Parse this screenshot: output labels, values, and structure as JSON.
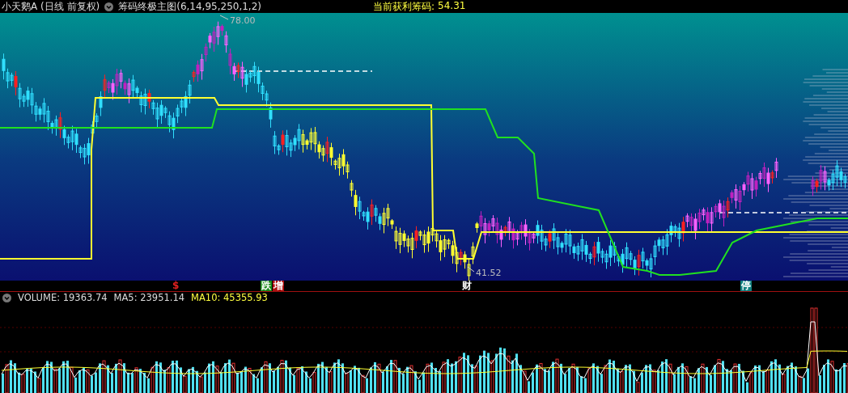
{
  "header": {
    "title": "小天鹅A (日线 前复权)",
    "indicator": "筹码终极主图(6,14,95,250,1,2)",
    "profit_label": "当前获利筹码:",
    "profit_value": "54.31"
  },
  "main_chart": {
    "high_label": "78.00",
    "low_label": "41.52"
  },
  "markers": [
    {
      "text": "$",
      "kind": "plain",
      "color": "#e02020"
    },
    {
      "text": "跌",
      "kind": "tag",
      "color": "#1a8a1a"
    },
    {
      "text": "增",
      "kind": "tag",
      "color": "#b01010"
    },
    {
      "text": "财",
      "kind": "plain",
      "color": "#ffffff"
    },
    {
      "text": "停",
      "kind": "tag",
      "color": "#108080"
    }
  ],
  "volume": {
    "title": "VOLUME: 19363.74",
    "ma5": "MA5: 23951.14",
    "ma10": "MA10: 45355.93"
  }
}
